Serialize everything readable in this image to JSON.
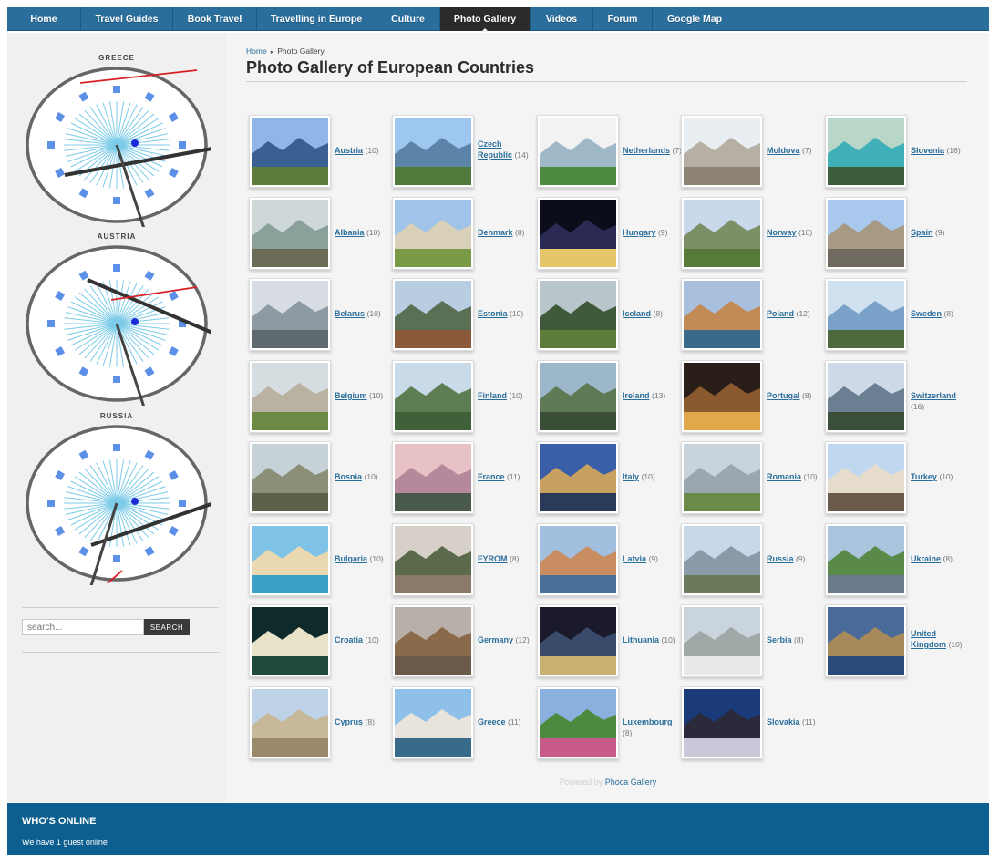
{
  "nav": {
    "items": [
      "Home",
      "Travel Guides",
      "Book Travel",
      "Travelling in Europe",
      "Culture",
      "Photo Gallery",
      "Videos",
      "Forum",
      "Google Map"
    ]
  },
  "sidebar": {
    "clocks": [
      {
        "title": "GREECE"
      },
      {
        "title": "AUSTRIA"
      },
      {
        "title": "RUSSIA"
      }
    ],
    "search": {
      "placeholder": "search...",
      "button_label": "SEARCH"
    }
  },
  "breadcrumb": {
    "home": "Home",
    "current": "Photo Gallery"
  },
  "page_title": "Photo Gallery of European Countries",
  "gallery": {
    "rows": [
      [
        {
          "name": "Austria",
          "count": "(10)"
        },
        {
          "name": "Czech Republic",
          "count": "(14)"
        },
        {
          "name": "Netherlands",
          "count": "(7)"
        },
        {
          "name": "Moldova",
          "count": "(7)"
        },
        {
          "name": "Slovenia",
          "count": "(16)"
        }
      ],
      [
        {
          "name": "Albania",
          "count": "(10)"
        },
        {
          "name": "Denmark",
          "count": "(8)"
        },
        {
          "name": "Hungary",
          "count": "(9)"
        },
        {
          "name": "Norway",
          "count": "(10)"
        },
        {
          "name": "Spain",
          "count": "(9)"
        }
      ],
      [
        {
          "name": "Belarus",
          "count": "(10)"
        },
        {
          "name": "Estonia",
          "count": "(10)"
        },
        {
          "name": "Iceland",
          "count": "(8)"
        },
        {
          "name": "Poland",
          "count": "(12)"
        },
        {
          "name": "Sweden",
          "count": "(8)"
        }
      ],
      [
        {
          "name": "Belgium",
          "count": "(10)"
        },
        {
          "name": "Finland",
          "count": "(10)"
        },
        {
          "name": "Ireland",
          "count": "(13)"
        },
        {
          "name": "Portugal",
          "count": "(8)"
        },
        {
          "name": "Switzerland",
          "count": "(16)"
        }
      ],
      [
        {
          "name": "Bosnia",
          "count": "(10)"
        },
        {
          "name": "France",
          "count": "(11)"
        },
        {
          "name": "Italy",
          "count": "(10)"
        },
        {
          "name": "Romania",
          "count": "(10)"
        },
        {
          "name": "Turkey",
          "count": "(10)"
        }
      ],
      [
        {
          "name": "Bulgaria",
          "count": "(10)"
        },
        {
          "name": "FYROM",
          "count": "(8)"
        },
        {
          "name": "Latvia",
          "count": "(9)"
        },
        {
          "name": "Russia",
          "count": "(9)"
        },
        {
          "name": "Ukraine",
          "count": "(8)"
        }
      ],
      [
        {
          "name": "Croatia",
          "count": "(10)"
        },
        {
          "name": "Germany",
          "count": "(12)"
        },
        {
          "name": "Lithuania",
          "count": "(10)"
        },
        {
          "name": "Serbia",
          "count": "(8)"
        },
        {
          "name": "United Kingdom",
          "count": "(10)"
        }
      ],
      [
        {
          "name": "Cyprus",
          "count": "(8)"
        },
        {
          "name": "Greece",
          "count": "(11)"
        },
        {
          "name": "Luxembourg",
          "count": "(8)"
        },
        {
          "name": "Slovakia",
          "count": "(11)"
        }
      ]
    ]
  },
  "powered_by": {
    "text": "Powered by",
    "link": "Phoca Gallery"
  },
  "footer": {
    "title": "WHO'S ONLINE",
    "text": "We have 1 guest online"
  },
  "colors": {
    "nav": "#2a6e9c",
    "nav_active": "#2b2b2b",
    "link": "#2a6e9c",
    "footer": "#0d5f8f"
  }
}
